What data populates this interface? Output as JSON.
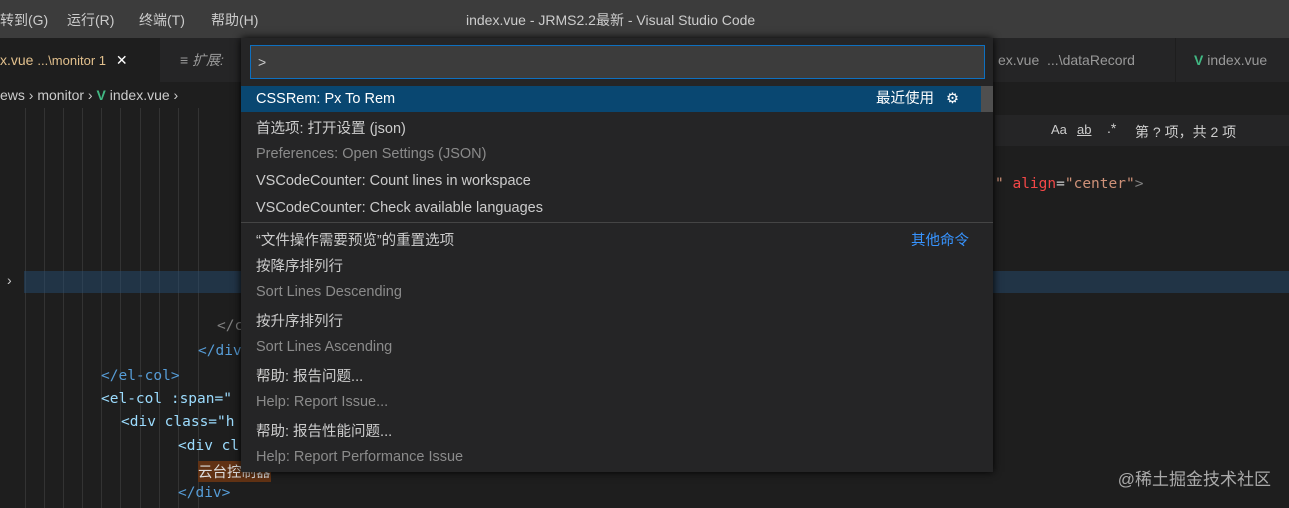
{
  "menu": [
    "转到(G)",
    "运行(R)",
    "终端(T)",
    "帮助(H)"
  ],
  "window_title": "index.vue - JRMS2.2最新 - Visual Studio Code",
  "tabs": [
    {
      "name": "x.vue",
      "path": "...\\monitor 1"
    },
    {
      "name": "扩展:"
    },
    {
      "name": "ex.vue",
      "path": "...\\dataRecord"
    },
    {
      "name": "index.vue"
    }
  ],
  "breadcrumb": [
    "ews",
    "monitor",
    "index.vue"
  ],
  "palette": {
    "input_value": ">",
    "items": [
      {
        "label": "CSSRem: Px To Rem",
        "right": "最近使用"
      },
      {
        "label": "首选项: 打开设置 (json)",
        "desc": "Preferences: Open Settings (JSON)"
      },
      {
        "label": "VSCodeCounter: Count lines in workspace"
      },
      {
        "label": "VSCodeCounter: Check available languages"
      },
      {
        "label": "“文件操作需要预览”的重置选项",
        "right": "其他命令"
      },
      {
        "label": "按降序排列行",
        "desc": "Sort Lines Descending"
      },
      {
        "label": "按升序排列行",
        "desc": "Sort Lines Ascending"
      },
      {
        "label": "帮助: 报告问题...",
        "desc": "Help: Report Issue..."
      },
      {
        "label": "帮助: 报告性能问题...",
        "desc": "Help: Report Performance Issue"
      }
    ]
  },
  "find": {
    "case": "Aa",
    "word": "ab",
    "regex": ".*",
    "result": "第 ? 项，共 2 项"
  },
  "code": {
    "align_attr": "align",
    "align_val": "\"center\"",
    "el_col_close": "</el-col>",
    "el_col_open": "<el-col :span=\"",
    "div_class": "<div class=\"h",
    "div_cl": "<div cl",
    "text": "云台控制器",
    "div_close": "</div>",
    "div_close2": "</div",
    "c_close": "</c"
  },
  "watermark": "@稀土掘金技术社区"
}
